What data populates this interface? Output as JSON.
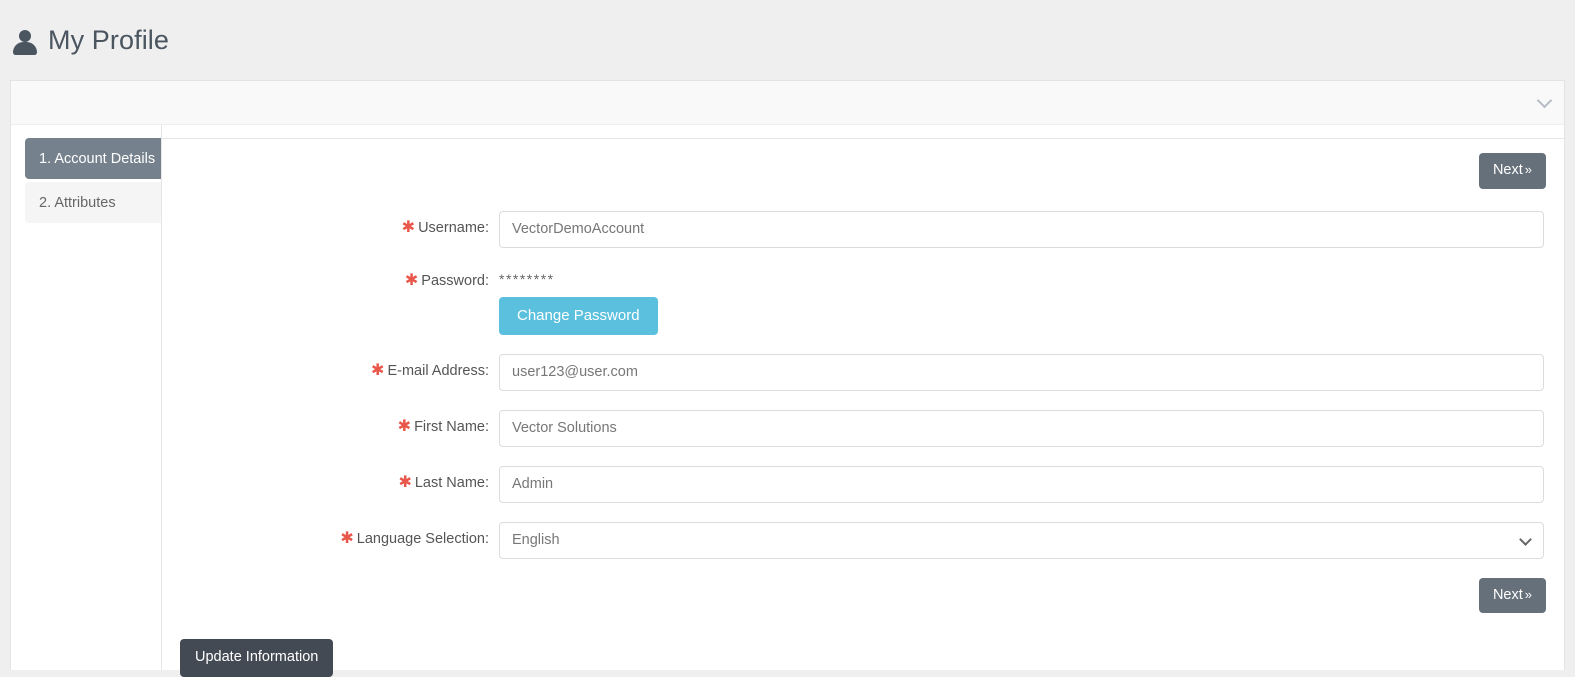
{
  "header": {
    "title": "My Profile",
    "icon": "person-icon"
  },
  "panel": {
    "collapse_icon": "chevron-down-icon"
  },
  "tabs": [
    {
      "label": "1. Account Details",
      "active": true
    },
    {
      "label": "2. Attributes",
      "active": false
    }
  ],
  "buttons": {
    "next_top": "Next",
    "next_bottom": "Next",
    "next_chevron": "»",
    "change_password": "Change Password",
    "update_information": "Update Information"
  },
  "form": {
    "required_marker": "✱",
    "fields": {
      "username": {
        "label": "Username:",
        "value": "VectorDemoAccount",
        "required": true
      },
      "password": {
        "label": "Password:",
        "masked_value": "********",
        "required": true
      },
      "email": {
        "label": "E-mail Address:",
        "value": "user123@user.com",
        "required": true
      },
      "first_name": {
        "label": "First Name:",
        "value": "Vector Solutions",
        "required": true
      },
      "last_name": {
        "label": "Last Name:",
        "value": "Admin",
        "required": true
      },
      "language": {
        "label": "Language Selection:",
        "value": "English",
        "required": true,
        "dropdown_icon": "chevron-down-icon"
      }
    }
  },
  "colors": {
    "active_tab": "#75818c",
    "required_star": "#e9574b",
    "change_password_btn": "#5bc0de",
    "next_btn": "#66707a",
    "update_btn": "#434a54",
    "page_background": "#efefef"
  }
}
